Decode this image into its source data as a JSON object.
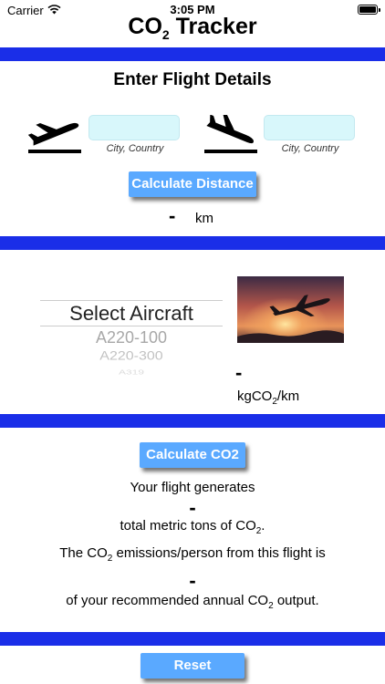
{
  "status_bar": {
    "carrier": "Carrier",
    "time": "3:05 PM"
  },
  "app": {
    "title_prefix": "CO",
    "title_sub": "2",
    "title_suffix": " Tracker"
  },
  "flight": {
    "section_title": "Enter Flight Details",
    "departure": {
      "value": "",
      "hint": "City, Country"
    },
    "arrival": {
      "value": "",
      "hint": "City, Country"
    },
    "calc_distance_label": "Calculate Distance",
    "distance_value": "-",
    "distance_unit": "km"
  },
  "aircraft": {
    "picker_selected": "Select Aircraft",
    "picker_options": [
      "A220-100",
      "A220-300",
      "A319"
    ],
    "emission_value": "-",
    "emission_unit_prefix": "kgCO",
    "emission_unit_sub": "2",
    "emission_unit_suffix": "/km"
  },
  "co2": {
    "calc_label": "Calculate CO2",
    "generates_text": "Your flight generates",
    "total_value": "-",
    "total_prefix": "total metric tons of CO",
    "total_sub": "2",
    "total_suffix": ".",
    "person_prefix": "The CO",
    "person_sub": "2",
    "person_suffix": " emissions/person from this flight is",
    "person_value": "-",
    "annual_prefix": "of your recommended annual CO",
    "annual_sub": "2",
    "annual_suffix": " output."
  },
  "reset_label": "Reset",
  "colors": {
    "divider": "#1a2ee8",
    "button": "#5aa9ff",
    "input": "#d8f7fb"
  },
  "icons": [
    "wifi-icon",
    "battery-icon",
    "takeoff-icon",
    "landing-icon",
    "airplane-sunset-photo"
  ]
}
